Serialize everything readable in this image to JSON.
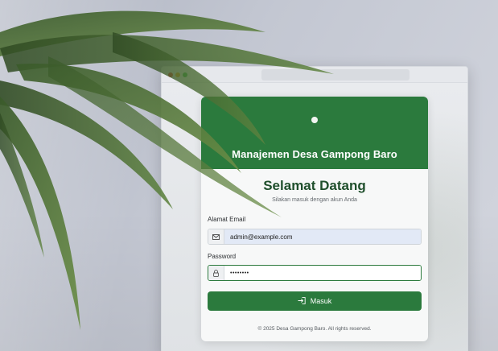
{
  "app_title": "Manajemen Desa Gampong Baro",
  "welcome_heading": "Selamat Datang",
  "subtitle": "Silakan masuk dengan akun Anda",
  "email": {
    "label": "Alamat Email",
    "value": "admin@example.com",
    "icon": "envelope-icon"
  },
  "password": {
    "label": "Password",
    "value": "••••••••",
    "icon": "lock-icon"
  },
  "submit": {
    "label": "Masuk",
    "icon": "sign-in-icon"
  },
  "footer": "© 2025 Desa Gampong Baro. All rights reserved.",
  "colors": {
    "primary_green": "#2b7a3d",
    "heading_green": "#1f4f2c"
  }
}
